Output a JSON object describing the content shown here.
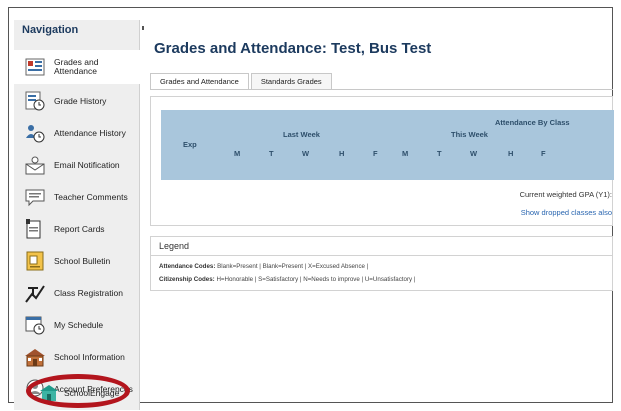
{
  "sidebar": {
    "title": "Navigation",
    "items": [
      {
        "label": "Grades and Attendance",
        "icon": "grades-attendance-icon"
      },
      {
        "label": "Grade History",
        "icon": "grade-history-icon"
      },
      {
        "label": "Attendance History",
        "icon": "attendance-history-icon"
      },
      {
        "label": "Email Notification",
        "icon": "email-icon"
      },
      {
        "label": "Teacher Comments",
        "icon": "comments-icon"
      },
      {
        "label": "Report Cards",
        "icon": "report-card-icon"
      },
      {
        "label": "School Bulletin",
        "icon": "bulletin-icon"
      },
      {
        "label": "Class Registration",
        "icon": "registration-icon"
      },
      {
        "label": "My Schedule",
        "icon": "schedule-icon"
      },
      {
        "label": "School Information",
        "icon": "school-icon"
      },
      {
        "label": "Account Preferences",
        "icon": "account-icon"
      },
      {
        "label": "SchoolEngage",
        "icon": "school-engage-icon"
      }
    ]
  },
  "main": {
    "title": "Grades and Attendance: Test, Bus Test",
    "tabs": [
      {
        "label": "Grades and Attendance"
      },
      {
        "label": "Standards Grades"
      }
    ],
    "attendance": {
      "title": "Attendance By Class",
      "exp_label": "Exp",
      "last_week": "Last Week",
      "this_week": "This Week",
      "last_days": [
        "M",
        "T",
        "W",
        "H",
        "F"
      ],
      "this_days": [
        "M",
        "T",
        "W",
        "H",
        "F"
      ]
    },
    "gpa_text": "Current weighted GPA (Y1):",
    "dropped_link": "Show dropped classes also"
  },
  "legend": {
    "title": "Legend",
    "attendance_label": "Attendance Codes:",
    "attendance_text": "Blank=Present | Blank=Present | X=Excused Absence |",
    "citizenship_label": "Citizenship Codes:",
    "citizenship_text": "H=Honorable | S=Satisfactory | N=Needs to improve | U=Unsatisfactory |"
  },
  "colors": {
    "title": "#1c3a5e",
    "table_header": "#a9c6dc",
    "link": "#2a66b0",
    "highlight_oval": "#b3151d"
  }
}
